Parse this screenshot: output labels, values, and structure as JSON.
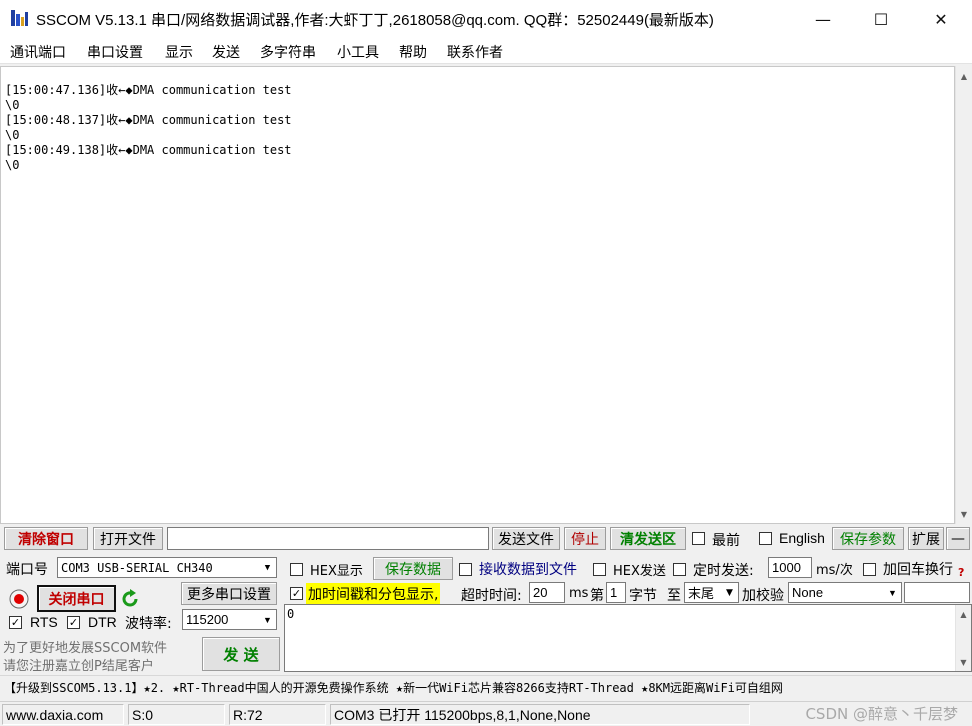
{
  "window": {
    "title": "SSCOM V5.13.1 串口/网络数据调试器,作者:大虾丁丁,2618058@qq.com. QQ群：52502449(最新版本)",
    "minimize": "—",
    "maximize": "☐",
    "close": "✕"
  },
  "menu": [
    "通讯端口",
    "串口设置",
    "显示",
    "发送",
    "多字符串",
    "小工具",
    "帮助",
    "联系作者"
  ],
  "receive": {
    "lines": [
      "[15:00:47.136]收←◆DMA communication test",
      "\\0",
      "[15:00:48.137]收←◆DMA communication test",
      "\\0",
      "[15:00:49.138]收←◆DMA communication test",
      "\\0"
    ]
  },
  "toolbar": {
    "clear_window": "清除窗口",
    "open_file": "打开文件",
    "file_path": "",
    "send_file": "发送文件",
    "stop": "停止",
    "clear_send": "清发送区",
    "topmost": "最前",
    "english": "English",
    "save_params": "保存参数",
    "expand": "扩展",
    "collapse": "—"
  },
  "port": {
    "port_label": "端口号",
    "port_value": "COM3 USB-SERIAL CH340",
    "more_settings": "更多串口设置",
    "close_port": "关闭串口",
    "rts": "RTS",
    "dtr": "DTR",
    "baud_label": "波特率:",
    "baud_value": "115200"
  },
  "options": {
    "hex_display": "HEX显示",
    "save_data": "保存数据",
    "recv_to_file": "接收数据到文件",
    "hex_send": "HEX发送",
    "timed_send": "定时发送:",
    "interval_value": "1000",
    "interval_unit": "ms/次",
    "add_crlf": "加回车换行",
    "timestamp_packet": "加时间戳和分包显示,",
    "timeout_label": "超时时间:",
    "timeout_value": "20",
    "timeout_unit": "ms",
    "byte_prefix": "第",
    "byte_value": "1",
    "byte_unit": "字节",
    "to_label": "至",
    "end_value": "末尾",
    "checksum_label": "加校验",
    "checksum_value": "None"
  },
  "send": {
    "text": "0",
    "button": "发 送",
    "promo_line1": "为了更好地发展SSCOM软件",
    "promo_line2": "请您注册嘉立创P结尾客户"
  },
  "notice": "【升级到SSCOM5.13.1】★2. ★RT-Thread中国人的开源免费操作系统 ★新一代WiFi芯片兼容8266支持RT-Thread ★8KM远距离WiFi可自组网",
  "status": {
    "website": "www.daxia.com",
    "sent": "S:0",
    "received": "R:72",
    "port_status": "COM3 已打开  115200bps,8,1,None,None"
  },
  "watermark": "CSDN @醉意丶千层梦",
  "colors": {
    "highlight_yellow": "#ffff00",
    "button_red": "#c00000",
    "button_green": "#008000"
  }
}
